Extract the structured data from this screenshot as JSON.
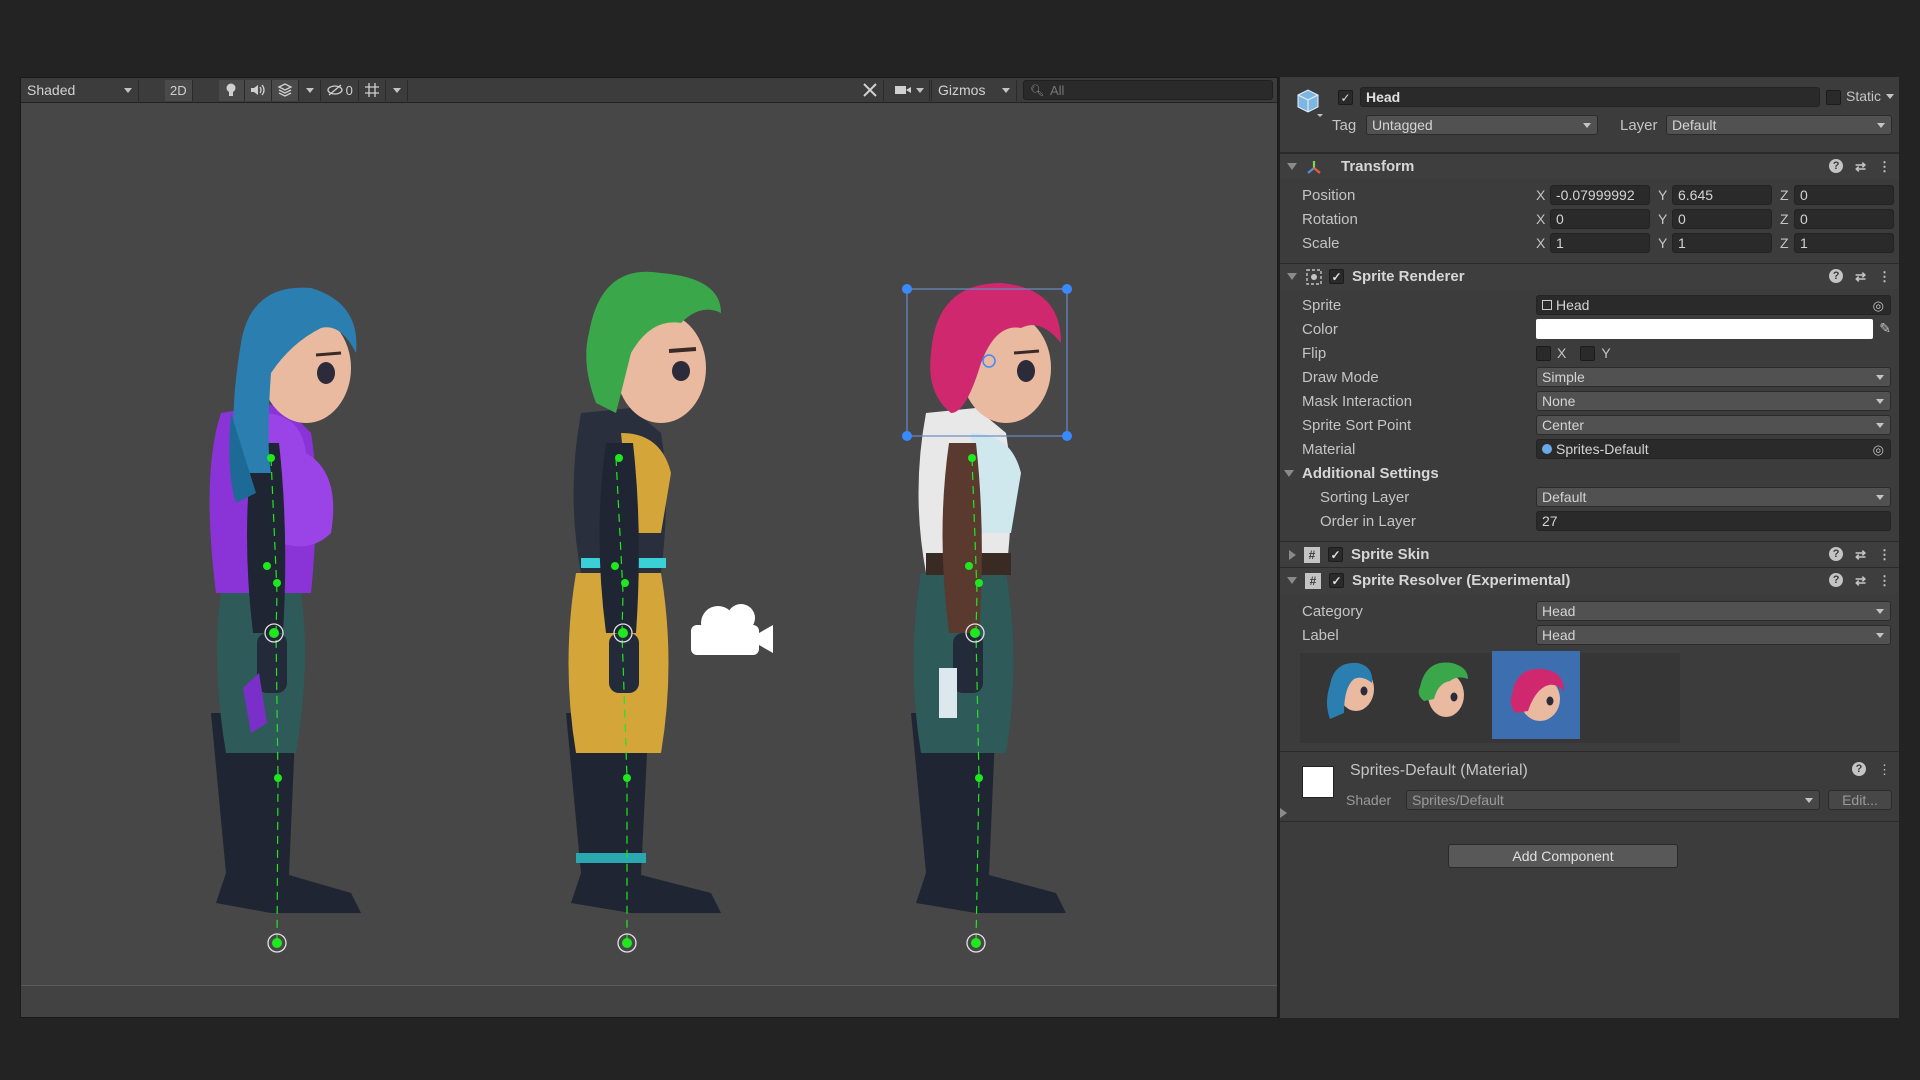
{
  "scene": {
    "toolbar": {
      "shading_mode": "Shaded",
      "mode_2d": "2D",
      "hidden_count": "0",
      "gizmos": "Gizmos",
      "search_placeholder": "All"
    }
  },
  "inspector": {
    "object": {
      "name": "Head",
      "active": true,
      "static_label": "Static",
      "tag_label": "Tag",
      "tag_value": "Untagged",
      "layer_label": "Layer",
      "layer_value": "Default"
    },
    "transform": {
      "title": "Transform",
      "position_label": "Position",
      "rotation_label": "Rotation",
      "scale_label": "Scale",
      "axis_x": "X",
      "axis_y": "Y",
      "axis_z": "Z",
      "position": {
        "x": "-0.07999992",
        "y": "6.645",
        "z": "0"
      },
      "rotation": {
        "x": "0",
        "y": "0",
        "z": "0"
      },
      "scale": {
        "x": "1",
        "y": "1",
        "z": "1"
      }
    },
    "sprite_renderer": {
      "title": "Sprite Renderer",
      "sprite_label": "Sprite",
      "sprite_value": "Head",
      "color_label": "Color",
      "color_value": "#ffffff",
      "flip_label": "Flip",
      "flip_x": "X",
      "flip_y": "Y",
      "draw_mode_label": "Draw Mode",
      "draw_mode_value": "Simple",
      "mask_interaction_label": "Mask Interaction",
      "mask_interaction_value": "None",
      "sort_point_label": "Sprite Sort Point",
      "sort_point_value": "Center",
      "material_label": "Material",
      "material_value": "Sprites-Default",
      "additional_settings_label": "Additional Settings",
      "sorting_layer_label": "Sorting Layer",
      "sorting_layer_value": "Default",
      "order_in_layer_label": "Order in Layer",
      "order_in_layer_value": "27"
    },
    "sprite_skin": {
      "title": "Sprite Skin"
    },
    "sprite_resolver": {
      "title": "Sprite Resolver (Experimental)",
      "category_label": "Category",
      "category_value": "Head",
      "label_label": "Label",
      "label_value": "Head"
    },
    "material": {
      "title": "Sprites-Default (Material)",
      "shader_label": "Shader",
      "shader_value": "Sprites/Default",
      "edit_label": "Edit..."
    },
    "add_component_label": "Add Component"
  },
  "colors": {
    "selection_blue": "#3d6fb0",
    "bone_green": "#1fe81f",
    "hair_blue": "#2a7fb0",
    "hair_green": "#3aa84a",
    "hair_pink": "#d0286f"
  }
}
